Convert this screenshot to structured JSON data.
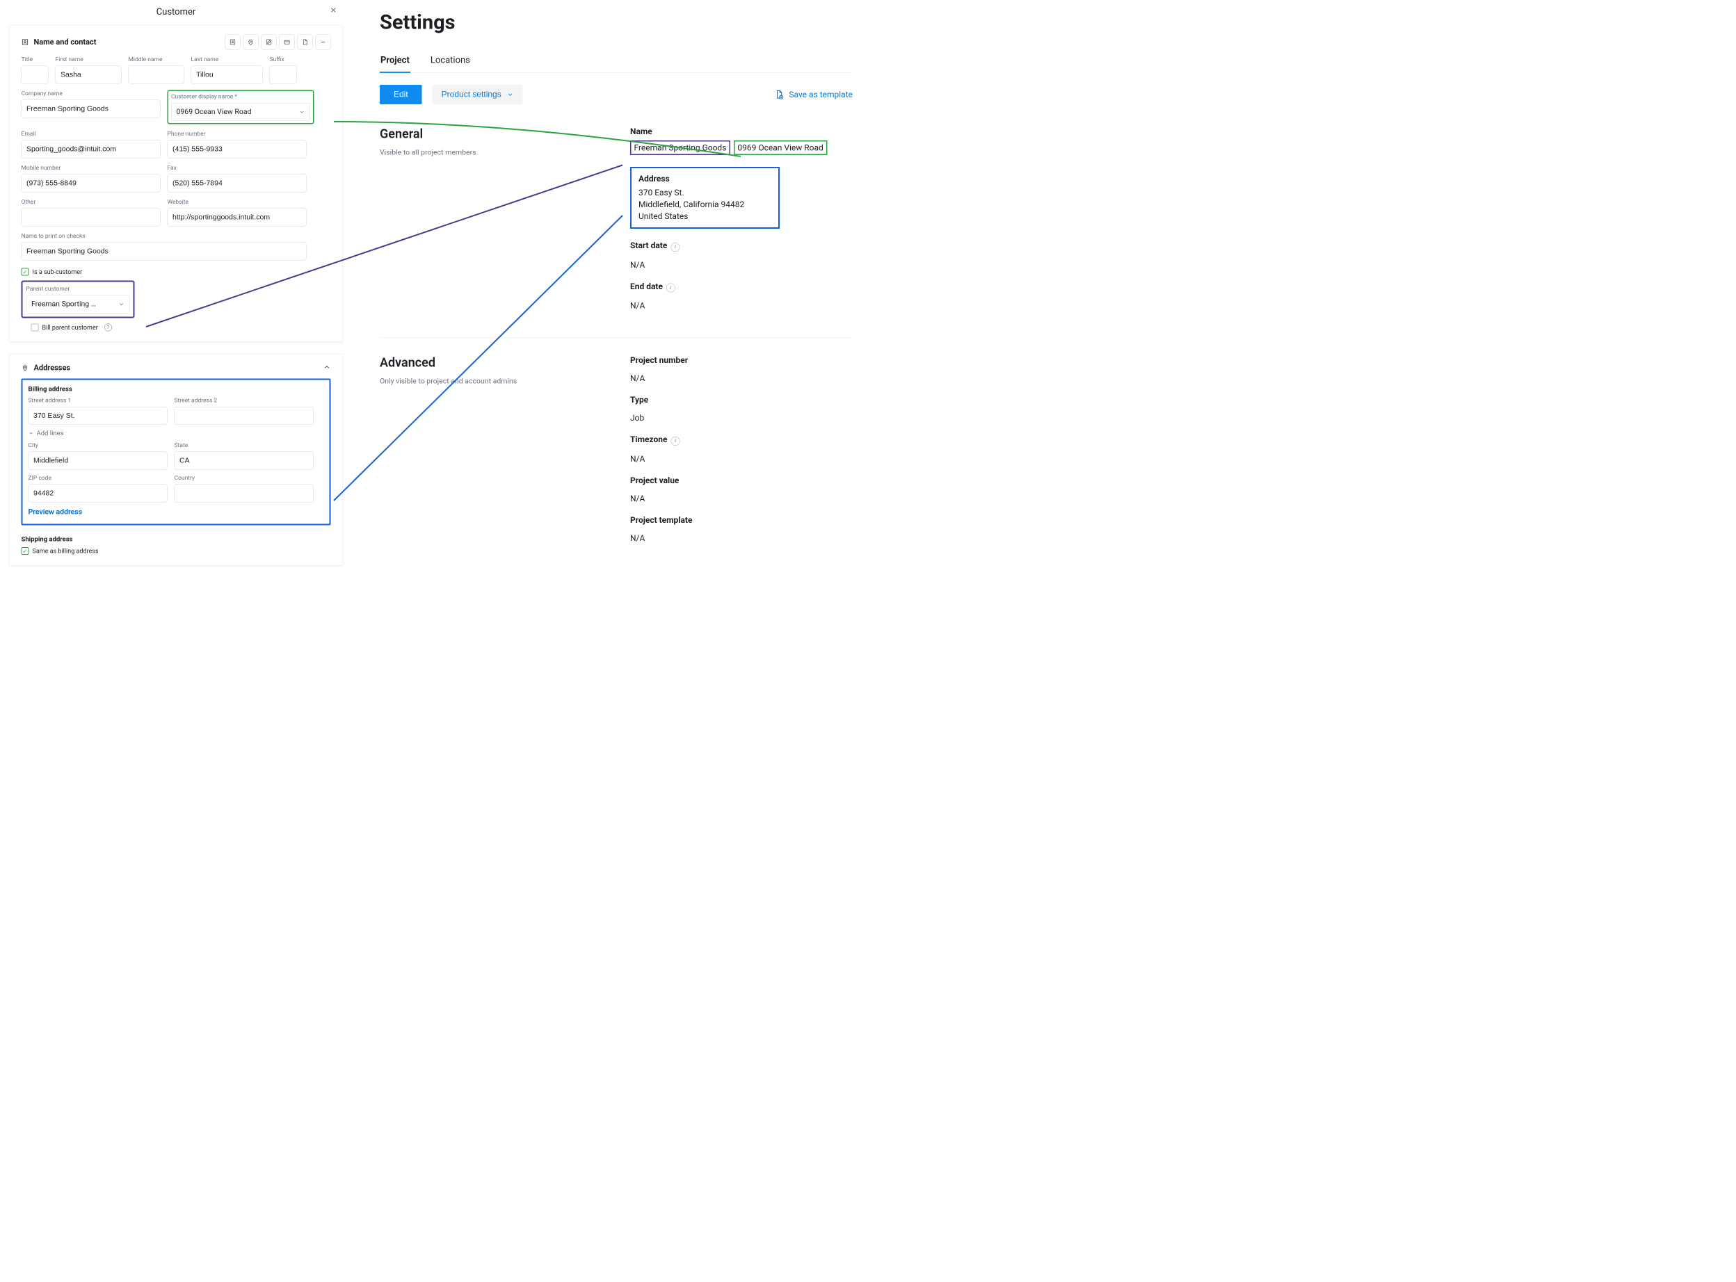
{
  "modal": {
    "title": "Customer",
    "section_name_contact": "Name and contact",
    "labels": {
      "title": "Title",
      "first_name": "First name",
      "middle_name": "Middle name",
      "last_name": "Last name",
      "suffix": "Suffix",
      "company": "Company name",
      "display": "Customer display name *",
      "email": "Email",
      "phone": "Phone number",
      "mobile": "Mobile number",
      "fax": "Fax",
      "other": "Other",
      "website": "Website",
      "print_name": "Name to print on checks",
      "is_sub": "Is a sub-customer",
      "parent": "Parent customer",
      "bill_parent": "Bill parent customer"
    },
    "values": {
      "first_name": "Sasha",
      "last_name": "Tillou",
      "company": "Freeman Sporting Goods",
      "display": "0969 Ocean View Road",
      "email": "Sporting_goods@intuit.com",
      "phone": "(415) 555-9933",
      "mobile": "(973) 555-8849",
      "fax": "(520) 555-7894",
      "website": "http://sportinggoods.intuit.com",
      "print_name": "Freeman Sporting Goods",
      "parent": "Freeman Sporting …"
    }
  },
  "addresses": {
    "section": "Addresses",
    "billing_title": "Billing address",
    "labels": {
      "s1": "Street address 1",
      "s2": "Street address 2",
      "addlines": "Add lines",
      "city": "City",
      "state": "State",
      "zip": "ZIP code",
      "country": "Country"
    },
    "values": {
      "s1": "370 Easy St.",
      "city": "Middlefield",
      "state": "CA",
      "zip": "94482"
    },
    "preview": "Preview address",
    "shipping_title": "Shipping address",
    "same": "Same as billing address"
  },
  "settings": {
    "heading": "Settings",
    "tabs": {
      "project": "Project",
      "locations": "Locations"
    },
    "buttons": {
      "edit": "Edit",
      "ps": "Product settings",
      "save_tmpl": "Save as template"
    },
    "general": {
      "title": "General",
      "sub": "Visible to all project members"
    },
    "advanced": {
      "title": "Advanced",
      "sub": "Only visible to project and account admins"
    },
    "fields": {
      "name_label": "Name",
      "name_company": "Freeman Sporting Goods",
      "name_display": "0969 Ocean View Road",
      "address_label": "Address",
      "address_l1": "370 Easy St.",
      "address_l2": "Middlefield, California 94482",
      "address_l3": "United States",
      "start_label": "Start date",
      "start_val": "N/A",
      "end_label": "End date",
      "end_val": "N/A",
      "pn_label": "Project number",
      "pn_val": "N/A",
      "type_label": "Type",
      "type_val": "Job",
      "tz_label": "Timezone",
      "tz_val": "N/A",
      "pv_label": "Project value",
      "pv_val": "N/A",
      "pt_label": "Project template",
      "pt_val": "N/A"
    }
  }
}
